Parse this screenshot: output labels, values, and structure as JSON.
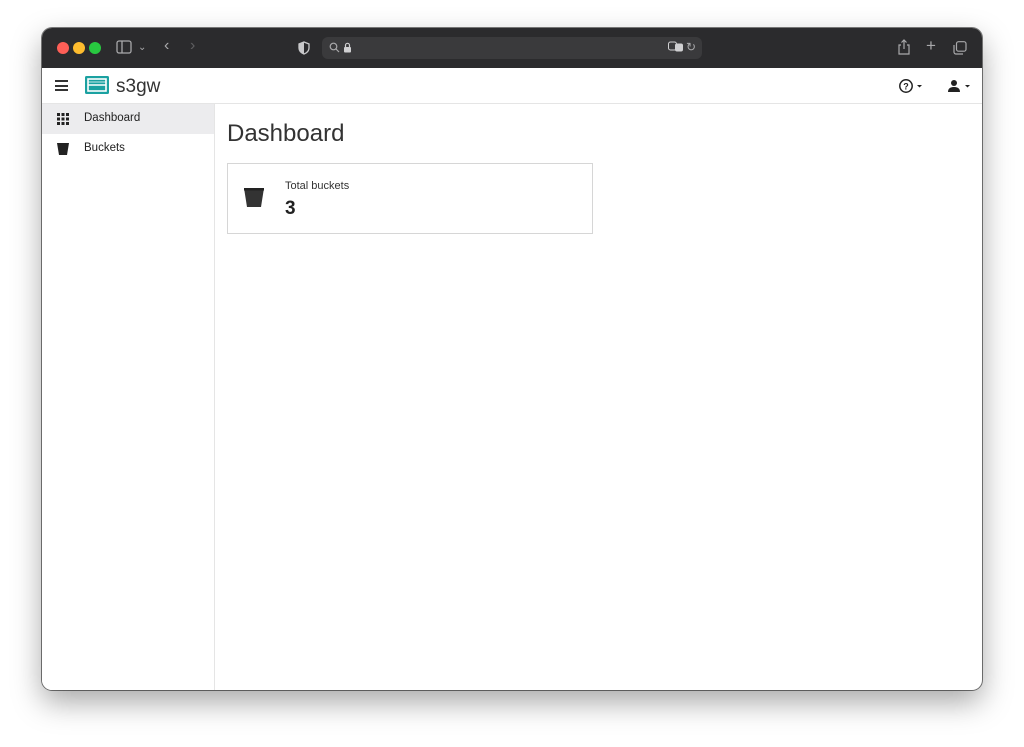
{
  "app": {
    "brand": "s3gw"
  },
  "sidebar": {
    "items": [
      {
        "label": "Dashboard",
        "icon": "grid-icon",
        "active": true
      },
      {
        "label": "Buckets",
        "icon": "bucket-icon",
        "active": false
      }
    ]
  },
  "main": {
    "title": "Dashboard",
    "cards": [
      {
        "label": "Total buckets",
        "value": "3",
        "icon": "bucket-icon"
      }
    ]
  },
  "header": {
    "help_icon": "help-circle-icon",
    "user_icon": "user-icon"
  },
  "colors": {
    "brand": "#1ba1a1",
    "toolbar": "#2b2b2d",
    "active_nav": "#ececee"
  }
}
